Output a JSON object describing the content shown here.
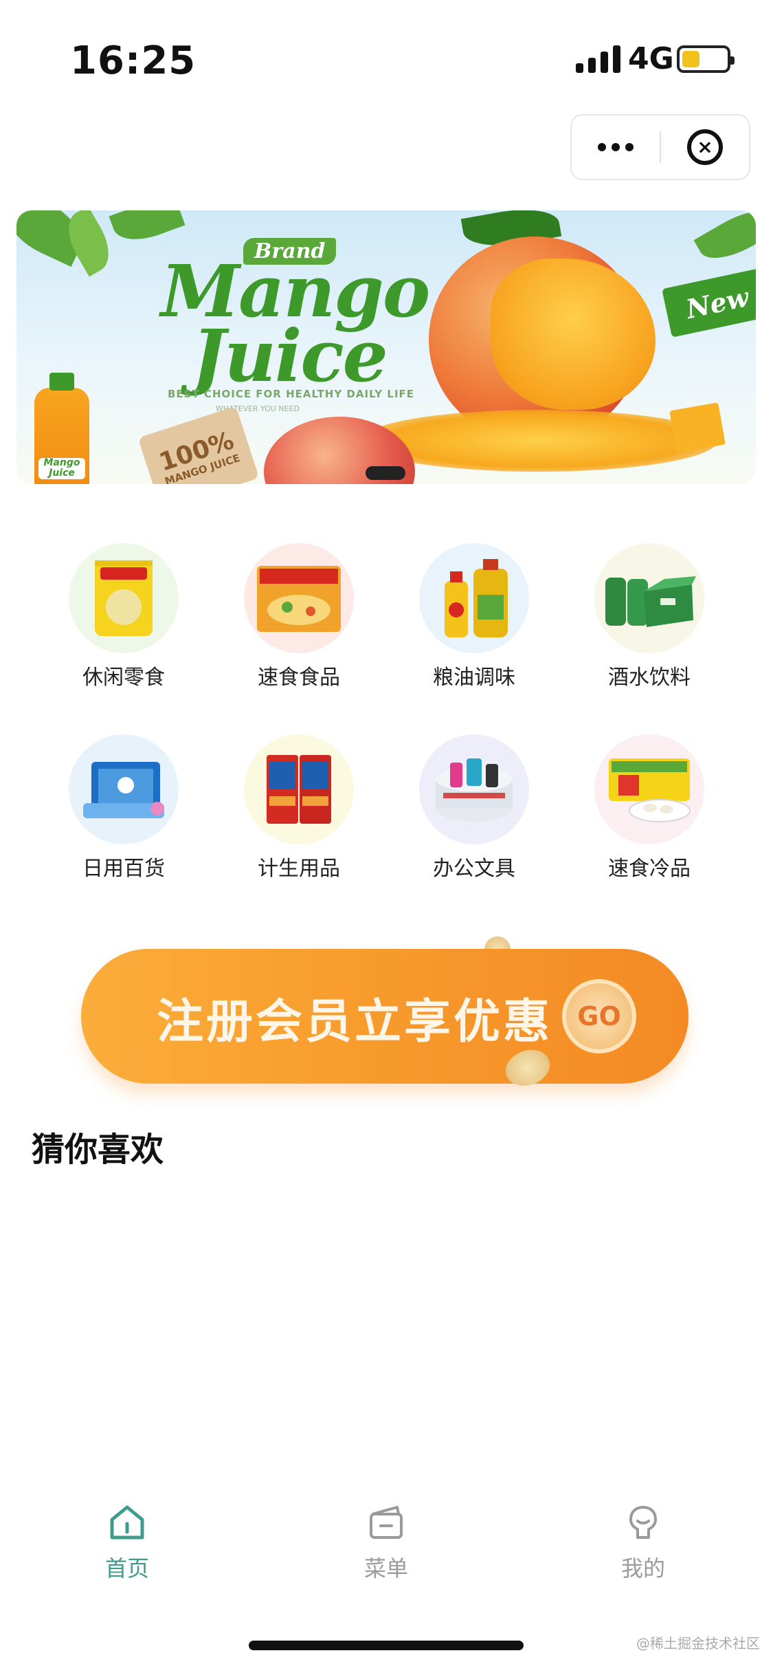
{
  "status_bar": {
    "time": "16:25",
    "network": "4G"
  },
  "capsule": {
    "more_icon": "more-dots-icon",
    "close_icon": "close-circle-icon"
  },
  "banner": {
    "brand": "Brand",
    "title_line1": "Mango",
    "title_line2": "Juice",
    "tagline": "BEST CHOICE FOR HEALTHY DAILY LIFE",
    "subtag": "WHATEVER YOU NEED",
    "new_badge": "New",
    "bottle_label": "Mango Juice",
    "stamp_value": "100%",
    "stamp_text": "MANGO JUICE"
  },
  "categories": [
    {
      "label": "休闲零食",
      "icon": "snack-bag-icon",
      "bg": "#eef8e8"
    },
    {
      "label": "速食食品",
      "icon": "instant-noodle-icon",
      "bg": "#fde9e6"
    },
    {
      "label": "粮油调味",
      "icon": "cooking-oil-icon",
      "bg": "#e8f3fc"
    },
    {
      "label": "酒水饮料",
      "icon": "beverage-icon",
      "bg": "#f7f6e7"
    },
    {
      "label": "日用百货",
      "icon": "tissue-box-icon",
      "bg": "#e8f2fb"
    },
    {
      "label": "计生用品",
      "icon": "family-care-icon",
      "bg": "#fbf9df"
    },
    {
      "label": "办公文具",
      "icon": "stationery-icon",
      "bg": "#eeeefb"
    },
    {
      "label": "速食冷品",
      "icon": "frozen-dumpling-icon",
      "bg": "#fbeff1"
    }
  ],
  "promo": {
    "text": "注册会员立享优惠",
    "go": "GO"
  },
  "section": {
    "title": "猜你喜欢"
  },
  "tabbar": {
    "tabs": [
      {
        "label": "首页",
        "icon": "home-icon",
        "active": true
      },
      {
        "label": "菜单",
        "icon": "menu-bag-icon",
        "active": false
      },
      {
        "label": "我的",
        "icon": "profile-icon",
        "active": false
      }
    ],
    "active_color": "#3f9c8c",
    "inactive_color": "#9a9a9a"
  },
  "watermark": "@稀土掘金技术社区"
}
